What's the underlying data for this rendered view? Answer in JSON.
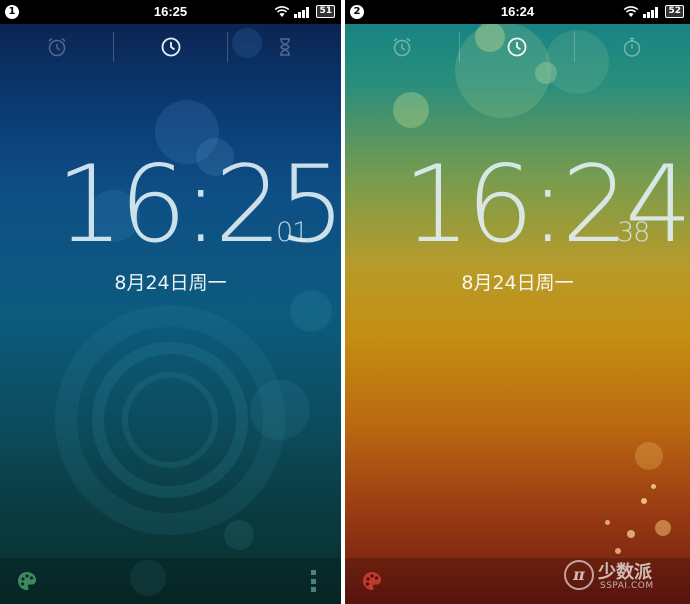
{
  "screen_1": {
    "badge": "1",
    "status_time": "16:25",
    "battery": "51",
    "clock_hm": "16:25",
    "clock_sec": "01",
    "date": "8月24日周一",
    "tabs": [
      "alarm-clock-icon",
      "clock-icon",
      "hourglass-timer-icon"
    ],
    "active_tab": 1
  },
  "screen_2": {
    "badge": "2",
    "status_time": "16:24",
    "battery": "52",
    "clock_hm": "16:24",
    "clock_sec": "38",
    "date": "8月24日周一",
    "tabs": [
      "alarm-clock-icon",
      "clock-icon",
      "stopwatch-icon"
    ],
    "active_tab": 1
  },
  "watermark": {
    "logo": "π",
    "name": "少数派",
    "site": "SSPAI.COM"
  },
  "colors": {
    "screen_1_top": "#0b1f4a",
    "screen_1_bottom": "#082e2c",
    "screen_2_top": "#0f7f86",
    "screen_2_bottom": "#6a1712",
    "palette_icon_1": "#3f8a5c",
    "palette_icon_2": "#c0392b"
  }
}
